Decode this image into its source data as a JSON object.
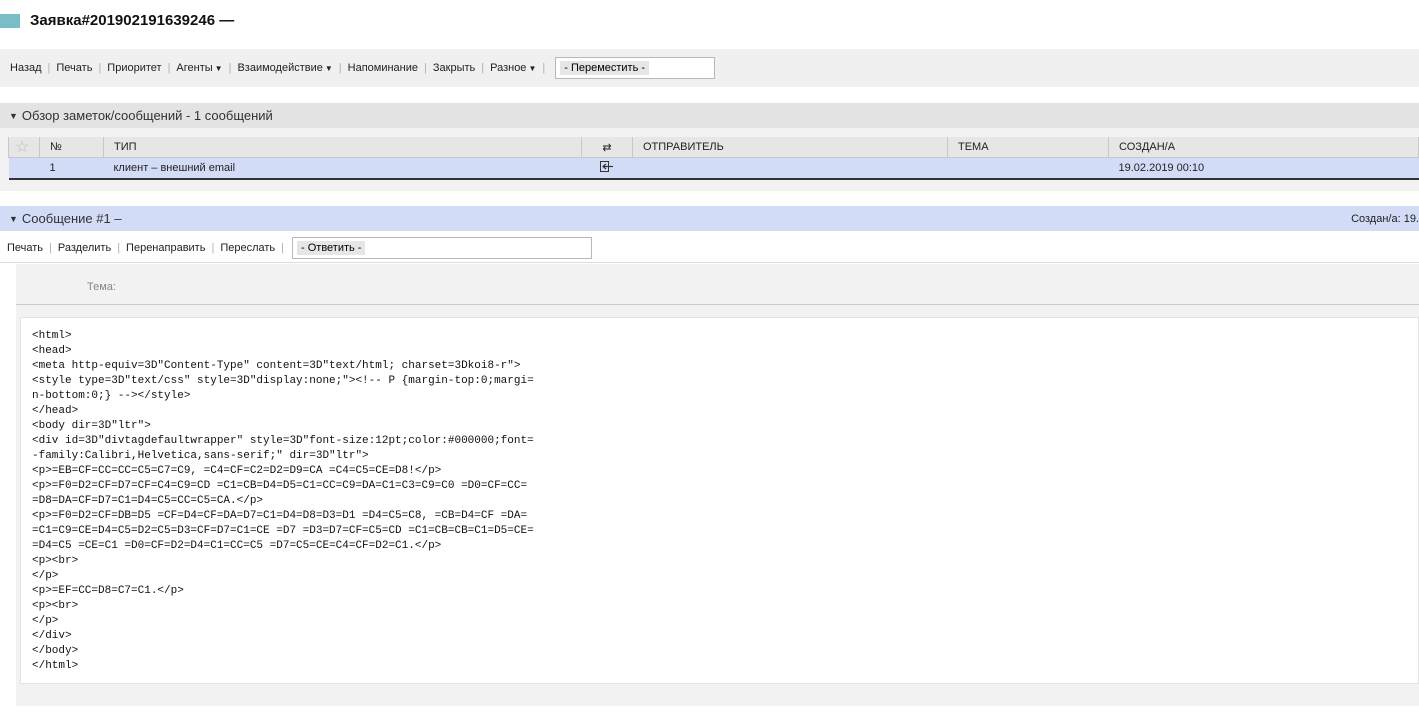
{
  "title": "Заявка#201902191639246 —",
  "toolbar": {
    "items": [
      {
        "label": "Назад",
        "caret": false
      },
      {
        "label": "Печать",
        "caret": false
      },
      {
        "label": "Приоритет",
        "caret": false
      },
      {
        "label": "Агенты",
        "caret": true
      },
      {
        "label": "Взаимодействие",
        "caret": true
      },
      {
        "label": "Напоминание",
        "caret": false
      },
      {
        "label": "Закрыть",
        "caret": false
      },
      {
        "label": "Разное",
        "caret": true
      }
    ],
    "move_select": "- Переместить -"
  },
  "notes_section": {
    "title": "Обзор заметок/сообщений - 1 сообщений",
    "columns": {
      "num": "№",
      "type": "ТИП",
      "direction_icon": "⇄",
      "sender": "ОТПРАВИТЕЛЬ",
      "subject": "ТЕМА",
      "created": "СОЗДАН/А"
    },
    "rows": [
      {
        "num": "1",
        "type": "клиент – внешний email",
        "direction_icon": "inbound-icon",
        "sender": "",
        "subject": "",
        "created": "19.02.2019 00:10"
      }
    ]
  },
  "message": {
    "title": "Сообщение #1 –",
    "created_right": "Создан/а: 19.",
    "toolbar": {
      "items": [
        "Печать",
        "Разделить",
        "Перенаправить",
        "Переслать"
      ],
      "reply_select": "- Ответить -"
    },
    "subject_label": "Тема:",
    "body": "<html>\n<head>\n<meta http-equiv=3D\"Content-Type\" content=3D\"text/html; charset=3Dkoi8-r\">\n<style type=3D\"text/css\" style=3D\"display:none;\"><!-- P {margin-top:0;margi=\nn-bottom:0;} --></style>\n</head>\n<body dir=3D\"ltr\">\n<div id=3D\"divtagdefaultwrapper\" style=3D\"font-size:12pt;color:#000000;font=\n-family:Calibri,Helvetica,sans-serif;\" dir=3D\"ltr\">\n<p>=EB=CF=CC=CC=C5=C7=C9, =C4=CF=C2=D2=D9=CA =C4=C5=CE=D8!</p>\n<p>=F0=D2=CF=D7=CF=C4=C9=CD =C1=CB=D4=D5=C1=CC=C9=DA=C1=C3=C9=C0 =D0=CF=CC=\n=D8=DA=CF=D7=C1=D4=C5=CC=C5=CA.</p>\n<p>=F0=D2=CF=DB=D5 =CF=D4=CF=DA=D7=C1=D4=D8=D3=D1 =D4=C5=C8, =CB=D4=CF =DA=\n=C1=C9=CE=D4=C5=D2=C5=D3=CF=D7=C1=CE =D7 =D3=D7=CF=C5=CD =C1=CB=CB=C1=D5=CE=\n=D4=C5 =CE=C1 =D0=CF=D2=D4=C1=CC=C5 =D7=C5=CE=C4=CF=D2=C1.</p>\n<p><br>\n</p>\n<p>=EF=CC=D8=C7=C1.</p>\n<p><br>\n</p>\n</div>\n</body>\n</html>"
  }
}
